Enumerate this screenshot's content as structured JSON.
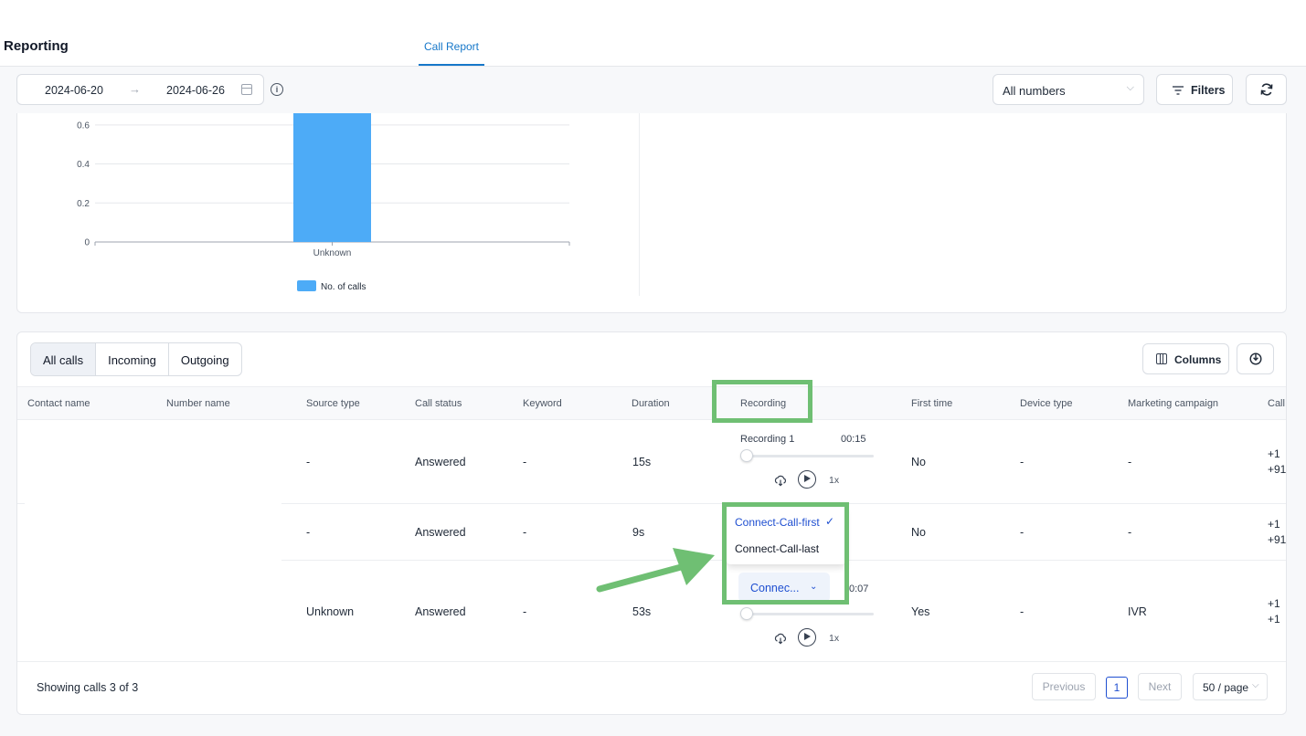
{
  "header": {
    "title": "Reporting",
    "tab": "Call Report"
  },
  "toolbar": {
    "date_start": "2024-06-20",
    "date_end": "2024-06-26",
    "numbers_select": "All numbers",
    "filters_label": "Filters"
  },
  "chart_data": {
    "type": "bar",
    "categories": [
      "Unknown"
    ],
    "series": [
      {
        "name": "No. of calls",
        "values": [
          0.66
        ]
      }
    ],
    "y_ticks": [
      "0",
      "0.2",
      "0.4",
      "0.6"
    ],
    "ylim": [
      0,
      0.66
    ],
    "bar_color": "#4dabf7",
    "grid": true,
    "legend": "bottom"
  },
  "table": {
    "tabs": [
      "All calls",
      "Incoming",
      "Outgoing"
    ],
    "columns_label": "Columns",
    "headers": [
      "Contact name",
      "Number name",
      "Source type",
      "Call status",
      "Keyword",
      "Duration",
      "Recording",
      "First time",
      "Device type",
      "Marketing campaign",
      "Call"
    ],
    "rows": [
      {
        "source": "-",
        "status": "Answered",
        "keyword": "-",
        "duration": "15s",
        "first_time": "No",
        "device": "-",
        "campaign": "-",
        "call_1": "+1",
        "call_2": "+91"
      },
      {
        "source": "-",
        "status": "Answered",
        "keyword": "-",
        "duration": "9s",
        "first_time": "No",
        "device": "-",
        "campaign": "-",
        "call_1": "+1",
        "call_2": "+91"
      },
      {
        "source": "Unknown",
        "status": "Answered",
        "keyword": "-",
        "duration": "53s",
        "first_time": "Yes",
        "device": "-",
        "campaign": "IVR",
        "call_1": "+1",
        "call_2": "+1"
      }
    ],
    "recording": {
      "label": "Recording 1",
      "time": "00:15",
      "speed": "1x",
      "time_2": "0:07",
      "speed_2": "1x",
      "dropdown_options": [
        "Connect-Call-first",
        "Connect-Call-last"
      ],
      "selected_check": "✓",
      "select_value": "Connec..."
    }
  },
  "footer": {
    "showing": "Showing calls 3 of 3",
    "previous": "Previous",
    "page": "1",
    "next": "Next",
    "page_size": "50 / page"
  },
  "highlight_color": "#6fbf73"
}
